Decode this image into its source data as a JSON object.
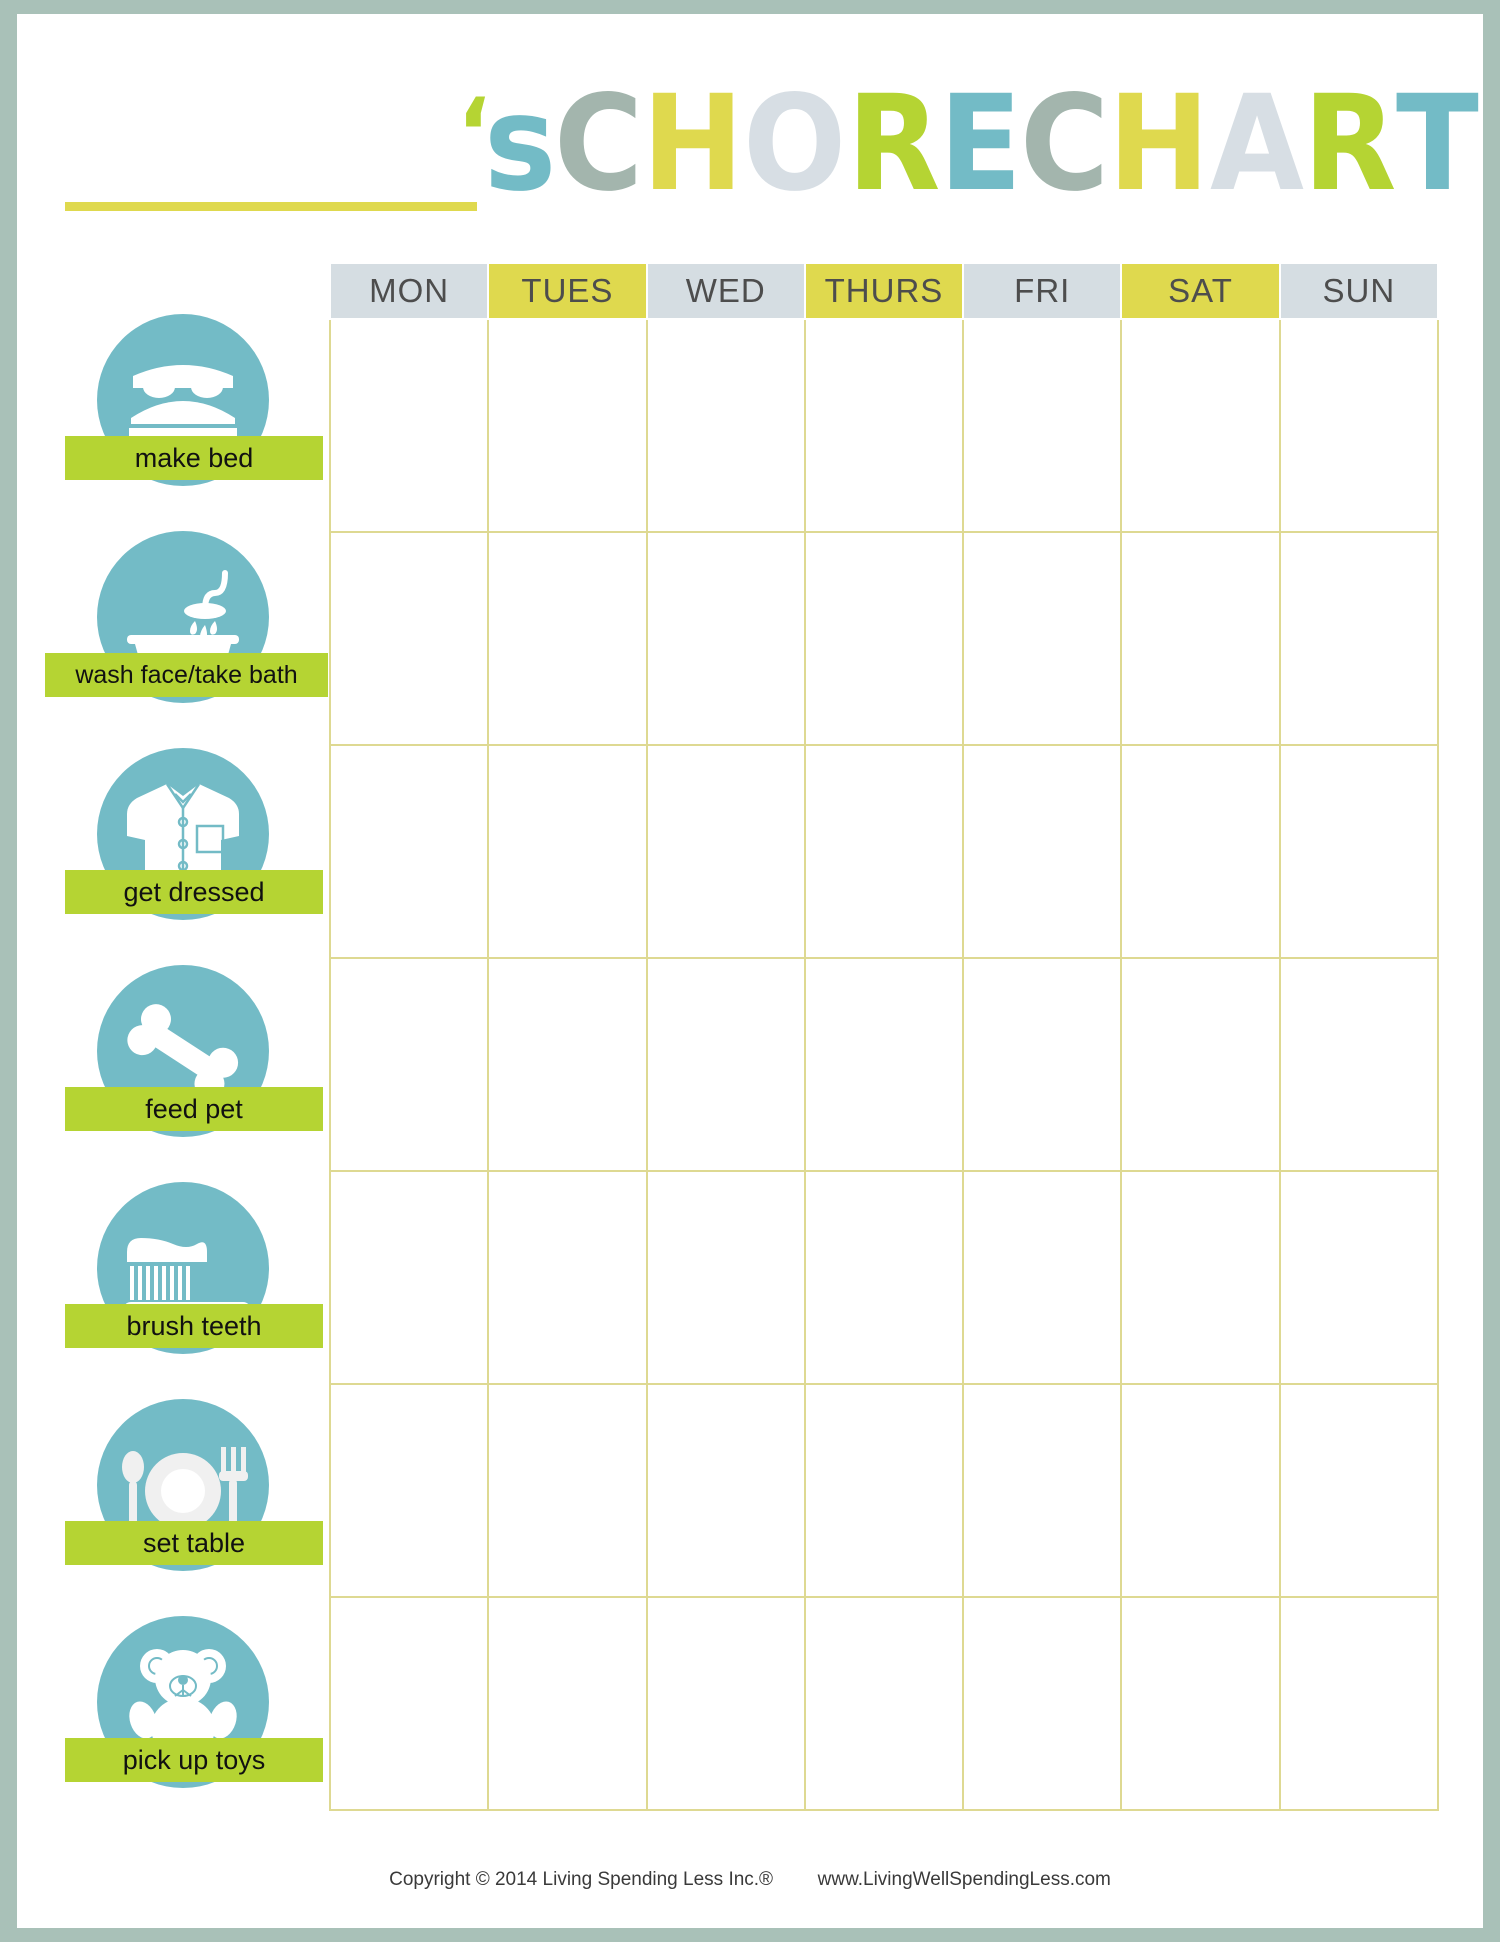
{
  "document": {
    "title_prefix_blank": "",
    "title_apostrophe_s": "'s",
    "title_word1": "CHORE",
    "title_word2": "CHART",
    "title_letters": [
      {
        "ch": "'",
        "color": "#b5d433"
      },
      {
        "ch": "s",
        "color": "#73bbc6"
      },
      {
        "ch": "C",
        "color": "#a3b5ad"
      },
      {
        "ch": "H",
        "color": "#dfd94e"
      },
      {
        "ch": "O",
        "color": "#d7dee4"
      },
      {
        "ch": "R",
        "color": "#b5d433"
      },
      {
        "ch": "E",
        "color": "#73bbc6"
      },
      {
        "ch": "C",
        "color": "#a3b5ad"
      },
      {
        "ch": "H",
        "color": "#dfd94e"
      },
      {
        "ch": "A",
        "color": "#d7dee4"
      },
      {
        "ch": "R",
        "color": "#b5d433"
      },
      {
        "ch": "T",
        "color": "#73bbc6"
      }
    ]
  },
  "grid": {
    "day_headers": [
      {
        "label": "MON",
        "style": "gray"
      },
      {
        "label": "TUES",
        "style": "yellow"
      },
      {
        "label": "WED",
        "style": "gray"
      },
      {
        "label": "THURS",
        "style": "yellow"
      },
      {
        "label": "FRI",
        "style": "gray"
      },
      {
        "label": "SAT",
        "style": "yellow"
      },
      {
        "label": "SUN",
        "style": "gray"
      }
    ],
    "cell_value": ""
  },
  "chores": [
    {
      "label": "make bed",
      "icon": "bed-icon"
    },
    {
      "label": "wash face/take bath",
      "icon": "bathtub-shower-icon"
    },
    {
      "label": "get dressed",
      "icon": "shirt-icon"
    },
    {
      "label": "feed pet",
      "icon": "bone-icon"
    },
    {
      "label": "brush teeth",
      "icon": "toothbrush-icon"
    },
    {
      "label": "set table",
      "icon": "place-setting-icon"
    },
    {
      "label": "pick up toys",
      "icon": "teddy-bear-icon"
    }
  ],
  "footer": {
    "copyright": "Copyright © 2014 Living Spending Less Inc.®",
    "website": "www.LivingWellSpendingLess.com"
  },
  "colors": {
    "page_border": "#a9c1b8",
    "teal_badge": "#73bbc6",
    "green_label": "#b5d433",
    "yellow": "#dfd94e",
    "gray_header": "#d5dde2",
    "grid_line": "#ded992",
    "sage": "#a3b5ad",
    "pale_blue": "#d7dee4"
  }
}
